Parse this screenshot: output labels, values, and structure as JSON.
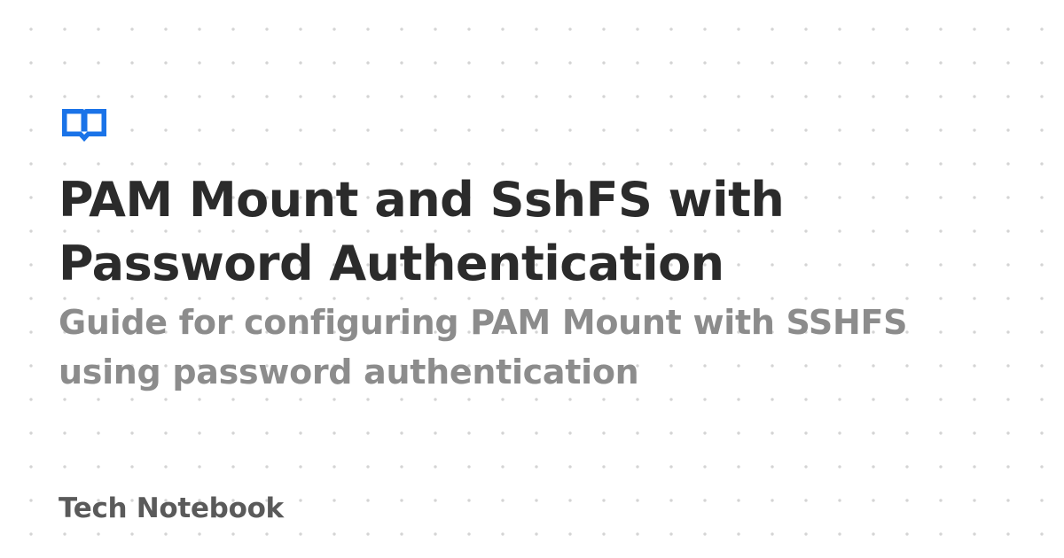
{
  "logo": {
    "icon": "book-icon",
    "color": "#1a73e8"
  },
  "title": "PAM Mount and SshFS with Password Authentication",
  "subtitle": "Guide for configuring PAM Mount with SSHFS using password authentication",
  "site_name": "Tech Notebook",
  "colors": {
    "title": "#2b2b2b",
    "subtitle": "#8c8c8c",
    "site_name": "#5a5a5a",
    "background_dots": "#d4d4d4"
  }
}
